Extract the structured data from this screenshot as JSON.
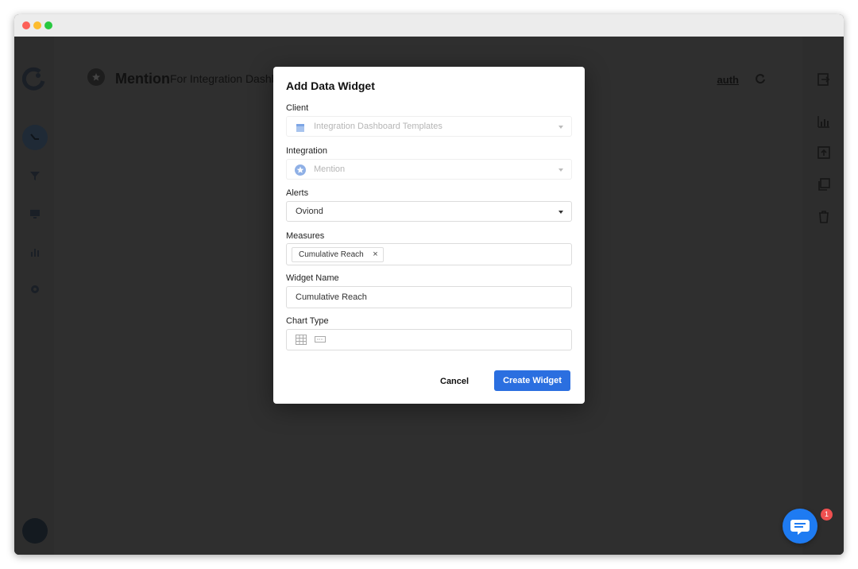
{
  "header": {
    "title": "Mention",
    "subtitle": "For Integration Dashbo",
    "auth_label": "auth"
  },
  "modal": {
    "title": "Add Data Widget",
    "client": {
      "label": "Client",
      "value": "Integration Dashboard Templates"
    },
    "integration": {
      "label": "Integration",
      "value": "Mention"
    },
    "alerts": {
      "label": "Alerts",
      "value": "Oviond"
    },
    "measures": {
      "label": "Measures",
      "chips": [
        "Cumulative Reach"
      ],
      "chip_remove": "×"
    },
    "widget_name": {
      "label": "Widget Name",
      "value": "Cumulative Reach"
    },
    "chart_type": {
      "label": "Chart Type",
      "options": [
        "table-icon",
        "scorecard-icon"
      ]
    },
    "cancel_label": "Cancel",
    "create_label": "Create Widget"
  },
  "chat": {
    "badge_count": "1"
  },
  "colors": {
    "primary": "#2b6fe0",
    "chat": "#1e7bf2",
    "badge": "#f05050"
  }
}
